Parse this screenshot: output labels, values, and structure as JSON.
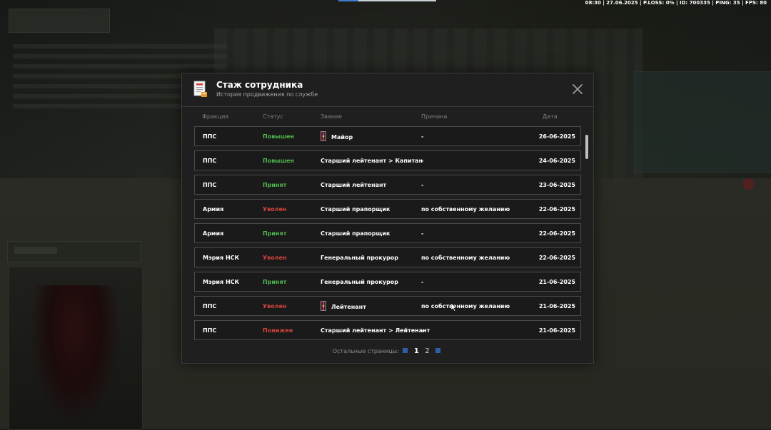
{
  "hud": {
    "status_text": "08:30 | 27.06.2025 | P.LOSS: 0% | ID: 700335 | PING: 35 | FPS: 80"
  },
  "modal": {
    "title": "Стаж сотрудника",
    "subtitle": "История продвижения по службе",
    "icon": "document-icon",
    "columns": {
      "faction": "Фракция",
      "status": "Статус",
      "rank": "Звание",
      "reason": "Причина",
      "date": "Дата"
    },
    "rows": [
      {
        "faction": "ППС",
        "status": "Повышен",
        "status_kind": "up",
        "rank": "Майор",
        "rank_icon": true,
        "reason": "-",
        "date": "26-06-2025"
      },
      {
        "faction": "ППС",
        "status": "Повышен",
        "status_kind": "up",
        "rank": "Старший лейтенант > Капитан",
        "rank_icon": false,
        "reason": "-",
        "date": "24-06-2025"
      },
      {
        "faction": "ППС",
        "status": "Принят",
        "status_kind": "in",
        "rank": "Старший лейтенант",
        "rank_icon": false,
        "reason": "-",
        "date": "23-06-2025"
      },
      {
        "faction": "Армия",
        "status": "Уволен",
        "status_kind": "out",
        "rank": "Старший прапорщик",
        "rank_icon": false,
        "reason": "по собственному желанию",
        "date": "22-06-2025"
      },
      {
        "faction": "Армия",
        "status": "Принят",
        "status_kind": "in",
        "rank": "Старший прапорщик",
        "rank_icon": false,
        "reason": "-",
        "date": "22-06-2025"
      },
      {
        "faction": "Мэрия НСК",
        "status": "Уволен",
        "status_kind": "out",
        "rank": "Генеральный прокурор",
        "rank_icon": false,
        "reason": "по собственному желанию",
        "date": "22-06-2025"
      },
      {
        "faction": "Мэрия НСК",
        "status": "Принят",
        "status_kind": "in",
        "rank": "Генеральный прокурор",
        "rank_icon": false,
        "reason": "-",
        "date": "21-06-2025"
      },
      {
        "faction": "ППС",
        "status": "Уволен",
        "status_kind": "out",
        "rank": "Лейтенант",
        "rank_icon": true,
        "reason": "по собственному желанию",
        "date": "21-06-2025"
      },
      {
        "faction": "ППС",
        "status": "Понижен",
        "status_kind": "down",
        "rank": "Старший лейтенант > Лейтенант",
        "rank_icon": false,
        "reason": "-",
        "date": "21-06-2025"
      }
    ],
    "pager": {
      "label": "Остальные страницы:",
      "pages": [
        "1",
        "2"
      ],
      "current": "1"
    }
  },
  "colors": {
    "status_positive": "#4fb84f",
    "status_negative": "#d2443f",
    "pager_arrow": "#2f5ea9"
  }
}
